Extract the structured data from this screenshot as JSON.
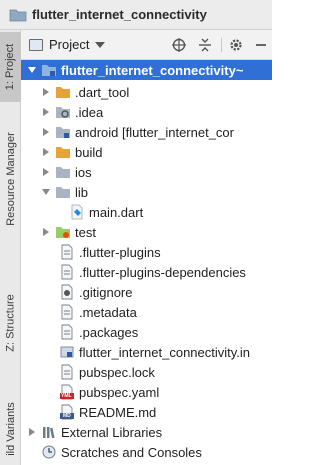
{
  "window": {
    "title": "flutter_internet_connectivity"
  },
  "left_strip": {
    "tabs": [
      {
        "label": "1: Project",
        "active": true
      },
      {
        "label": "Resource Manager",
        "active": false
      },
      {
        "label": "Z: Structure",
        "active": false
      },
      {
        "label": "ild Variants",
        "active": false
      }
    ]
  },
  "project_panel": {
    "view_label": "Project",
    "toolbar_icons": [
      "target-icon",
      "collapse-icon",
      "gear-icon",
      "hide-icon"
    ]
  },
  "tree": [
    {
      "label": "flutter_internet_connectivity",
      "suffix": " ~",
      "icon": "module-folder-icon",
      "arrow": "down",
      "selected": true
    },
    {
      "label": ".dart_tool",
      "icon": "folder-orange-icon",
      "arrow": "right"
    },
    {
      "label": ".idea",
      "icon": "folder-settings-icon",
      "arrow": "right"
    },
    {
      "label": "android [flutter_internet_cor",
      "icon": "folder-module-icon",
      "arrow": "right",
      "bold_part": "[flutter_internet_cor"
    },
    {
      "label": "build",
      "icon": "folder-orange-icon",
      "arrow": "right"
    },
    {
      "label": "ios",
      "icon": "folder-icon",
      "arrow": "right"
    },
    {
      "label": "lib",
      "icon": "folder-icon",
      "arrow": "down"
    },
    {
      "label": "main.dart",
      "icon": "dart-file-icon",
      "arrow": "none"
    },
    {
      "label": "test",
      "icon": "folder-test-icon",
      "arrow": "right"
    },
    {
      "label": ".flutter-plugins",
      "icon": "text-file-icon",
      "arrow": "none"
    },
    {
      "label": ".flutter-plugins-dependencies",
      "icon": "text-file-icon",
      "arrow": "none"
    },
    {
      "label": ".gitignore",
      "icon": "gitignore-file-icon",
      "arrow": "none"
    },
    {
      "label": ".metadata",
      "icon": "text-file-icon",
      "arrow": "none"
    },
    {
      "label": ".packages",
      "icon": "text-file-icon",
      "arrow": "none"
    },
    {
      "label": "flutter_internet_connectivity.in",
      "icon": "iml-file-icon",
      "arrow": "none"
    },
    {
      "label": "pubspec.lock",
      "icon": "text-file-icon",
      "arrow": "none"
    },
    {
      "label": "pubspec.yaml",
      "icon": "yaml-file-icon",
      "arrow": "none"
    },
    {
      "label": "README.md",
      "icon": "markdown-file-icon",
      "arrow": "none"
    },
    {
      "label": "External Libraries",
      "icon": "libraries-icon",
      "arrow": "right"
    },
    {
      "label": "Scratches and Consoles",
      "icon": "scratches-icon",
      "arrow": "none"
    }
  ],
  "badges": {
    "yaml": "YML",
    "markdown": "MD"
  },
  "colors": {
    "selection": "#2f6fd6",
    "folder": "#8fa9c4",
    "excluded_folder": "#e6a33a",
    "test_folder": "#7cb342"
  }
}
